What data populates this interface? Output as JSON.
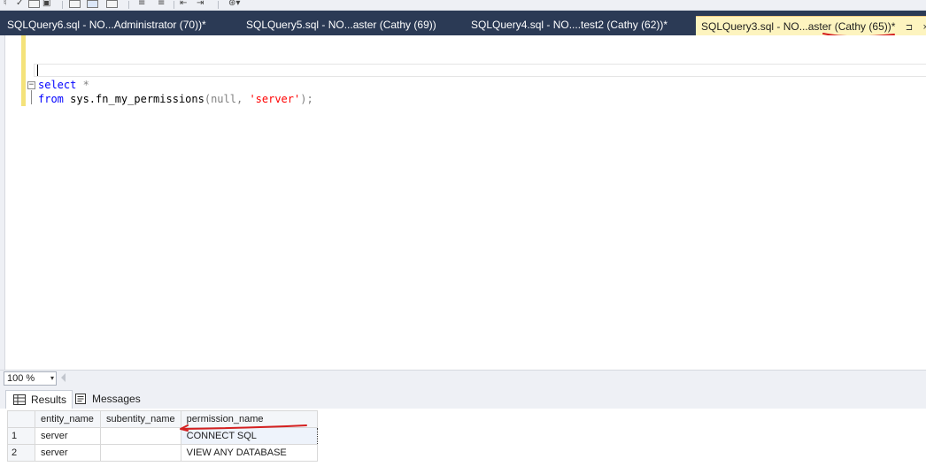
{
  "toolbar": {
    "icons": [
      "toolbar-icon",
      "execute-icon",
      "parse-icon",
      "display-plan-icon",
      "results-text-icon",
      "results-grid-icon",
      "results-file-icon",
      "comment-icon",
      "uncomment-icon",
      "outdent-icon",
      "indent-icon",
      "specify-values-icon"
    ]
  },
  "tabs": [
    {
      "label": "SQLQuery6.sql - NO...Administrator (70))*",
      "active": false
    },
    {
      "label": "SQLQuery5.sql - NO...aster (Cathy (69))",
      "active": false
    },
    {
      "label": "SQLQuery4.sql - NO....test2 (Cathy (62))*",
      "active": false
    },
    {
      "label": "SQLQuery3.sql - NO...aster (Cathy (65))*",
      "active": true
    }
  ],
  "active_tab": {
    "pin_glyph": "⊐",
    "close_glyph": "×"
  },
  "editor": {
    "line1": {
      "kw": "select",
      "rest": " *"
    },
    "line2": {
      "kw": "from",
      "obj": " sys.",
      "fn": "fn_my_permissions",
      "open": "(null, ",
      "str": "'server'",
      "close": ");"
    },
    "fold_glyph": "−"
  },
  "zoom": {
    "value": "100 %",
    "arrow": "▾"
  },
  "result_tabs": [
    {
      "label": "Results",
      "icon": "grid-icon",
      "active": true
    },
    {
      "label": "Messages",
      "icon": "messages-icon",
      "active": false
    }
  ],
  "grid": {
    "columns": [
      "entity_name",
      "subentity_name",
      "permission_name"
    ],
    "rows": [
      {
        "num": "1",
        "entity_name": "server",
        "subentity_name": "",
        "permission_name": "CONNECT SQL"
      },
      {
        "num": "2",
        "entity_name": "server",
        "subentity_name": "",
        "permission_name": "VIEW ANY DATABASE"
      }
    ]
  },
  "colors": {
    "tab_strip": "#2b3a55",
    "active_tab": "#fdf4bf",
    "annotation_red": "#d42020",
    "keyword": "#0000ff",
    "string": "#ff0000",
    "function": "#ff00ff"
  }
}
